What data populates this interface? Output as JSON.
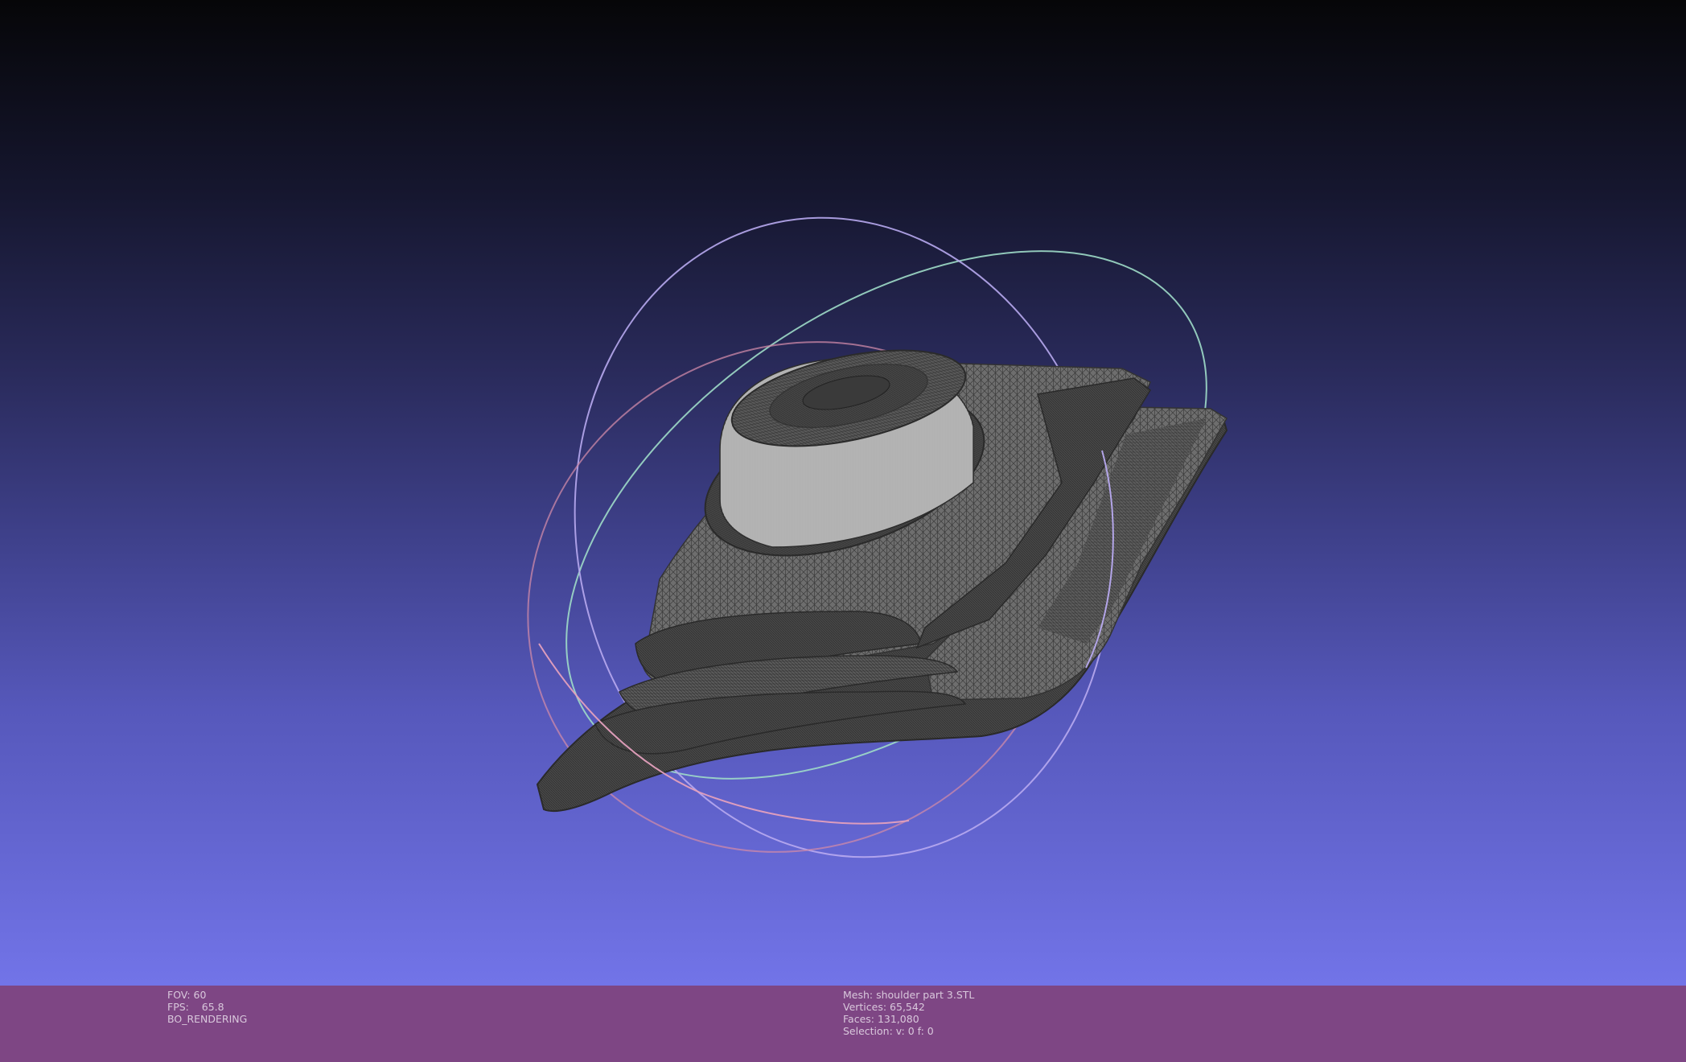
{
  "viewer": {
    "background_top": "#060608",
    "background_bottom": "#7274e8",
    "status_bar_color": "#7e4684",
    "trackball_colors": [
      "#d68aa8",
      "#9be0c8",
      "#b6a8ee"
    ]
  },
  "status": {
    "fov": "FOV: 60",
    "fps_label": "FPS:",
    "fps_value": "65.8",
    "render_mode": "BO_RENDERING",
    "mesh": "Mesh: shoulder part 3.STL",
    "vertices": "Vertices: 65,542",
    "faces": "Faces: 131,080",
    "selection": "Selection: v: 0 f: 0"
  }
}
